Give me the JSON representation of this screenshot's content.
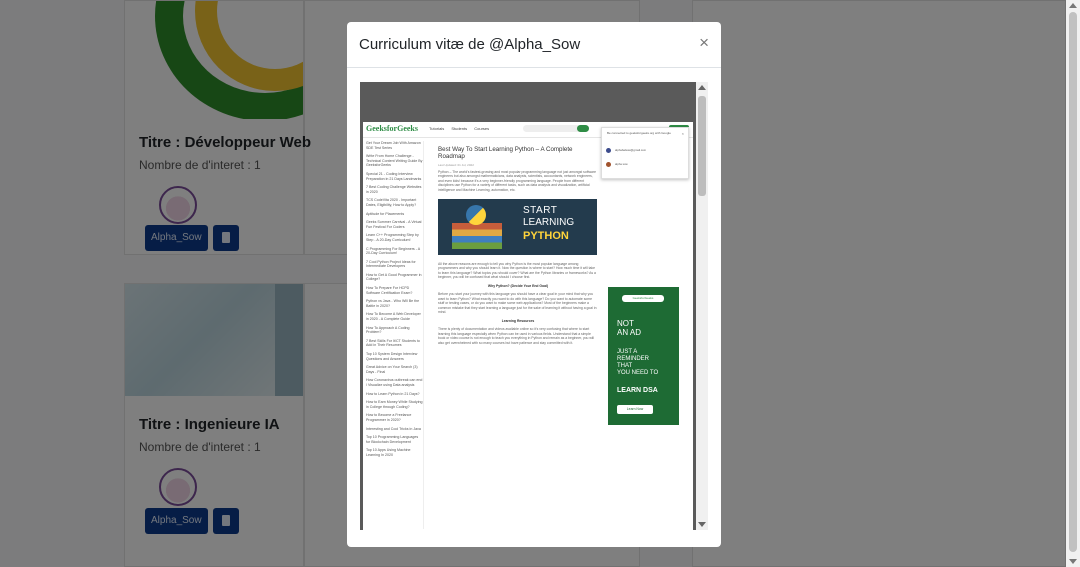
{
  "modal": {
    "title": "Curriculum vitæ de @Alpha_Sow",
    "close_label": "×"
  },
  "cards": [
    {
      "title": "Titre : Développeur Web",
      "interest": "Nombre de d'interet : 1",
      "username": "Alpha_Sow"
    },
    {
      "title": "Titre : Ingenieure IA",
      "interest": "Nombre de d'interet : 1",
      "username": "Alpha_Sow"
    }
  ],
  "pdf": {
    "site_logo": "GeeksforGeeks",
    "menu": [
      "Tutorials",
      "Students",
      "Courses"
    ],
    "popup_text": "Be connected to geeksforgeeks.org with Google",
    "popup_accounts": [
      "alphabalsow@gmail.com",
      "alpha sow"
    ],
    "article_title": "Best Way To Start Learning Python – A Complete Roadmap",
    "article_date": "Last Updated: 01 Jul, 2022",
    "intro": "Python – The world's fastest-growing and most popular programming language not just amongst software engineers but also amongst mathematicians, data analysts, scientists, accountants, network engineers, and even kids! because it's a very beginner-friendly programming language. People from different disciplines use Python for a variety of different tasks, such as data analysis and visualization, artificial intelligence and Machine Learning, automation, etc.",
    "banner": [
      "START",
      "LEARNING",
      "PYTHON"
    ],
    "para2": "All the above reasons are enough to tell you why Python is the most popular language among programmers and why you should learn it. Now the question is where to start? How much time it will take to learn this language? What topics you should cover? What are the Python libraries or frameworks? As a beginner, you will be confused that what should I choose first.",
    "subhead1": "Why Python? (Decide Your End Goal)",
    "para3": "Before you start your journey with this language you should have a clear goal in your mind that why you want to learn Python? What exactly you want to do with this language? Do you want to automate some stuff or testing cases, or do you want to make some web applications? Most of the beginners make a common mistake that they start learning a language just for the sake of learning it without having a goal in mind.",
    "subhead2": "Learning Resources",
    "para4": "There is plenty of documentation and videos available online so it's very confusing that where to start learning this language especially when Python can be used in various fields. Understand that a simple book or video course is not enough to teach you everything in Python and remain as a beginner, you will also get overwhelmed with so many courses but have patience and stay committed with it.",
    "sidebar": [
      "Get Your Dream Job With Amazon SDE Test Series",
      "Write From Home Challenge - Technical Content Writing Guide By GeeksforGeeks",
      "Special 21 - Coding Interview Preparation in 21 Days Landmarks",
      "7 Best Coding Challenge Websites in 2020",
      "TCS CodeVita 2020 - Important Dates, Eligibility, How to Apply?",
      "Aptitude for Placements",
      "Geeks Summer Carnival - A Virtual Fun Festival For Coders",
      "Learn C++ Programming Step by Step - A 20-Day Curriculum!",
      "C Programming For Beginners - A 20-Day Curriculum!",
      "7 Cool Python Project Ideas for Intermediate Developers",
      "How to Get A Good Programmer in College?",
      "How To Prepare For HCPD Software Certification Exam?",
      "Python vs Java - Who Will Be the Battle in 2020?",
      "How To Become A Web Developer in 2020 - A Complete Guide",
      "How To Approach A Coding Problem?",
      "7 Best Skills For It/CT Students to Add in Their Resumes",
      "Top 10 System Design Interview Questions and Answers",
      "Great Advice on Your Search (3) Days - Final",
      "How Coronavirus outbreak can end / Visualize using Data analysis",
      "How to Learn Python in 21 Days?",
      "How to Earn Money While Studying in College through Coding?",
      "How to Become a Freelance Programmer in 2020?",
      "Interesting and Cool Tricks in Java",
      "Top 10 Programming Languages for Blockchain Development",
      "Top 10 Apps Using Machine Learning In 2020"
    ],
    "ad": {
      "brand": "GeeksforGeeks",
      "line1": [
        "NOT",
        "AN AD"
      ],
      "line2": [
        "JUST A",
        "REMINDER",
        "THAT",
        "YOU NEED TO"
      ],
      "line3": "LEARN DSA",
      "button": "Learn Now"
    }
  }
}
